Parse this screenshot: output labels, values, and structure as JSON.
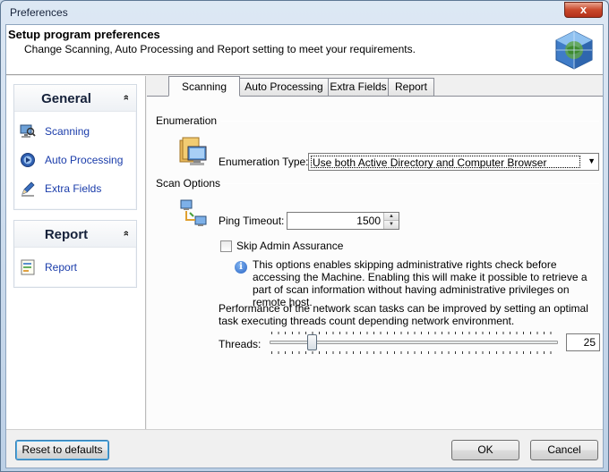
{
  "window": {
    "title": "Preferences",
    "close_glyph": "x"
  },
  "header": {
    "title": "Setup program preferences",
    "subtitle": "Change Scanning, Auto Processing and Report setting to meet your requirements.",
    "logo_icon": "globe-cube-icon"
  },
  "sidebar": {
    "groups": [
      {
        "title": "General",
        "collapse_glyph": "»",
        "items": [
          {
            "label": "Scanning",
            "icon": "computer-scan-icon"
          },
          {
            "label": "Auto Processing",
            "icon": "auto-process-icon"
          },
          {
            "label": "Extra Fields",
            "icon": "pencil-icon"
          }
        ]
      },
      {
        "title": "Report",
        "collapse_glyph": "»",
        "items": [
          {
            "label": "Report",
            "icon": "report-icon"
          }
        ]
      }
    ]
  },
  "tabs": [
    {
      "label": "Scanning",
      "active": true
    },
    {
      "label": "Auto Processing",
      "active": false
    },
    {
      "label": "Extra Fields",
      "active": false
    },
    {
      "label": "Report",
      "active": false
    }
  ],
  "scanning": {
    "enumeration": {
      "section_label": "Enumeration",
      "type_label": "Enumeration Type:",
      "type_value": "Use both Active Directory and Computer Browser"
    },
    "scan_options": {
      "section_label": "Scan Options",
      "ping_label": "Ping Timeout:",
      "ping_value": "1500",
      "skip_admin_label": "Skip Admin Assurance",
      "skip_admin_checked": false,
      "info_text": "This options enables skipping administrative rights check before accessing the Machine. Enabling this will make it possible to retrieve a part of scan information without having administrative privileges on remote host.",
      "perf_text": "Performance of the network scan tasks can be improved by setting an optimal task executing threads count depending network environment.",
      "threads_label": "Threads:",
      "threads_value": "25"
    }
  },
  "footer": {
    "reset_label": "Reset to defaults",
    "ok_label": "OK",
    "cancel_label": "Cancel"
  }
}
